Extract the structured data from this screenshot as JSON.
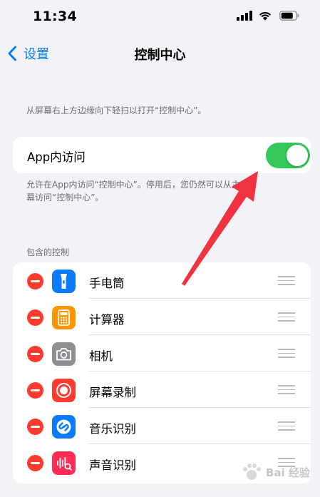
{
  "status_bar": {
    "time": "11:34",
    "icons": [
      "signal-icon",
      "wifi-icon",
      "battery-icon"
    ]
  },
  "nav": {
    "back_label": "设置",
    "title": "控制中心"
  },
  "hint_top": "从屏幕右上方边缘向下轻扫以打开“控制中心”。",
  "access": {
    "label": "App内访问",
    "enabled": true,
    "hint_line1": "允许在App内访问“控制中心”。停用后，您仍然可以从主屏",
    "hint_line2": "幕访问“控制中心”。"
  },
  "section_header": "包含的控制",
  "controls": [
    {
      "label": "手电筒",
      "icon": "flashlight-icon",
      "color": "#0a7aff"
    },
    {
      "label": "计算器",
      "icon": "calculator-icon",
      "color": "#ff9500"
    },
    {
      "label": "相机",
      "icon": "camera-icon",
      "color": "#8e8e93"
    },
    {
      "label": "屏幕录制",
      "icon": "screen-recording-icon",
      "color": "#ff3b30"
    },
    {
      "label": "音乐识别",
      "icon": "shazam-icon",
      "color": "#0a7aff"
    },
    {
      "label": "声音识别",
      "icon": "sound-recognition-icon",
      "color": "#ff2d55"
    }
  ],
  "colors": {
    "accent": "#007aff",
    "toggle_on": "#34c759",
    "remove": "#ff3b30",
    "annotation_arrow": "#ef3340"
  },
  "watermark": "Bai 经验"
}
